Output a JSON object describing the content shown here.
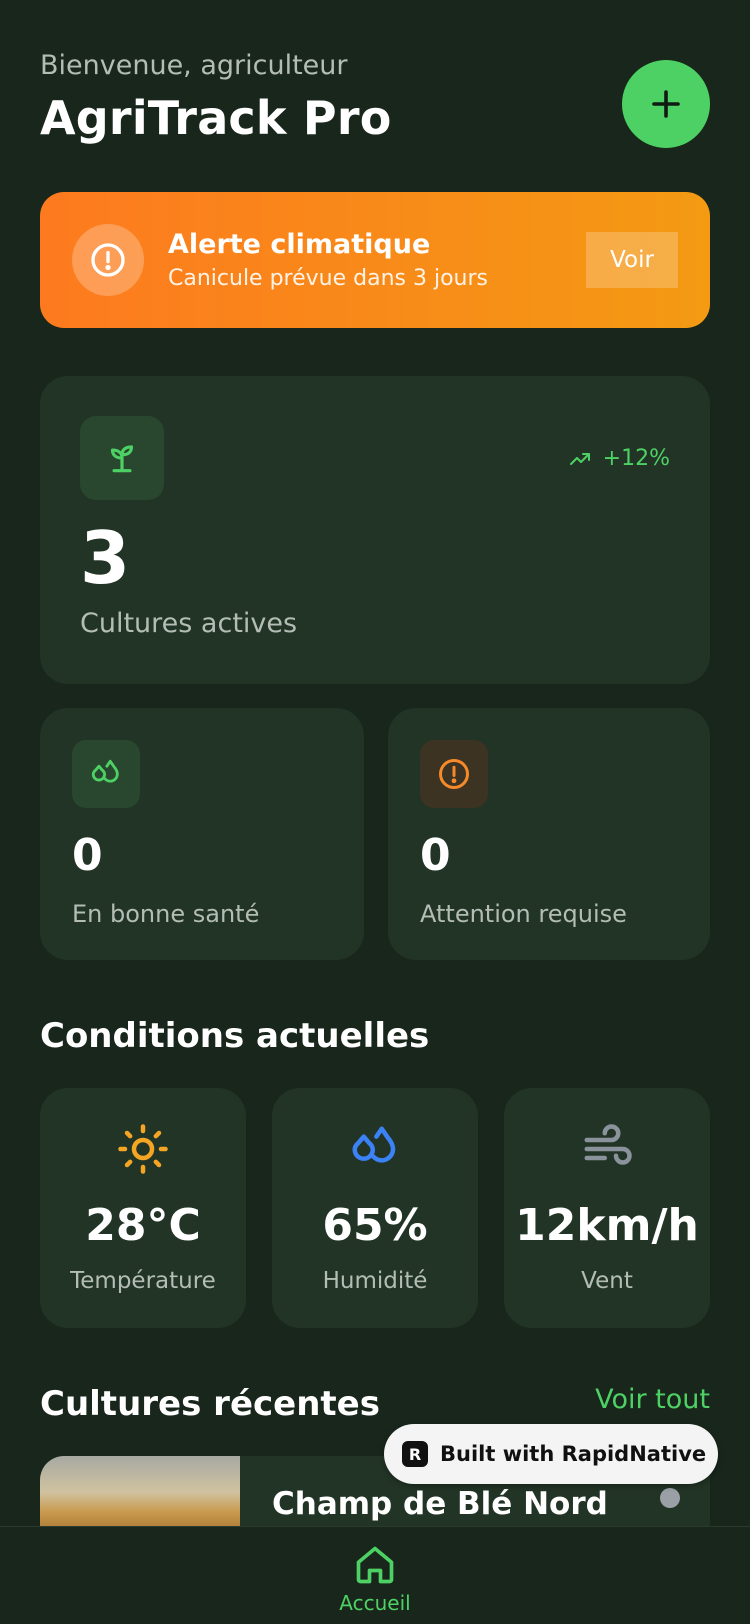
{
  "header": {
    "greeting": "Bienvenue, agriculteur",
    "title": "AgriTrack Pro",
    "add_icon": "plus-icon"
  },
  "alert": {
    "icon": "alert-circle-icon",
    "title": "Alerte climatique",
    "subtitle": "Canicule prévue dans 3 jours",
    "button_label": "Voir"
  },
  "stats": {
    "active": {
      "icon": "sprout-icon",
      "trend": "+12%",
      "value": "3",
      "label": "Cultures actives"
    },
    "healthy": {
      "icon": "droplets-icon",
      "value": "0",
      "label": "En bonne santé"
    },
    "attention": {
      "icon": "alert-circle-icon",
      "value": "0",
      "label": "Attention requise"
    }
  },
  "conditions": {
    "title": "Conditions actuelles",
    "items": [
      {
        "icon": "sun-icon",
        "value": "28°C",
        "label": "Température"
      },
      {
        "icon": "droplets-icon",
        "value": "65%",
        "label": "Humidité"
      },
      {
        "icon": "wind-icon",
        "value": "12km/h",
        "label": "Vent"
      }
    ]
  },
  "recent": {
    "title": "Cultures récentes",
    "see_all": "Voir tout",
    "items": [
      {
        "name": "Champ de Blé Nord"
      }
    ]
  },
  "badge": {
    "label": "Built with RapidNative"
  },
  "nav": {
    "items": [
      {
        "icon": "home-icon",
        "label": "Accueil"
      }
    ]
  },
  "colors": {
    "background": "#18261b",
    "card": "#223425",
    "accent_green": "#4ed164",
    "alert_start": "#fd7a1f",
    "alert_end": "#f49a13",
    "warning_orange": "#f58a2a",
    "humidity_blue": "#3b82f6",
    "sun_yellow": "#f5a524"
  }
}
